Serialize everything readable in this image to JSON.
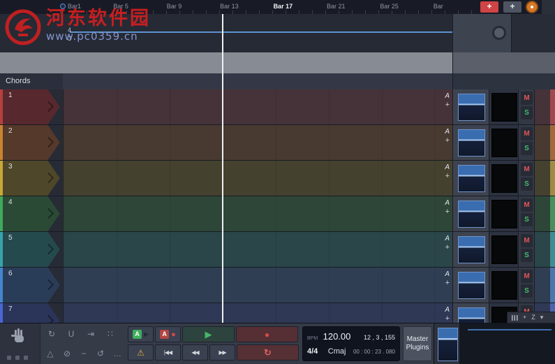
{
  "watermark": {
    "title": "河东软件园",
    "url": "www.pc0359.cn"
  },
  "ruler": {
    "bars": [
      {
        "label": "Bar1",
        "clock_icon": true
      },
      {
        "label": "Bar 5"
      },
      {
        "label": "Bar 9"
      },
      {
        "label": "Bar 13"
      },
      {
        "label": "Bar 17",
        "highlight": true
      },
      {
        "label": "Bar 21"
      },
      {
        "label": "Bar 25"
      },
      {
        "label": "Bar"
      }
    ],
    "add_track_label": "+",
    "add_label": "+"
  },
  "marker_area": {
    "beat": "4",
    "chord": "C"
  },
  "chords_row": {
    "label": "Chords"
  },
  "track_controls": {
    "automation": "A",
    "add": "+",
    "mute": "M",
    "solo": "S"
  },
  "tracks": [
    {
      "number": "1",
      "strip": "#b5403f",
      "header": "#57282e",
      "lane": "#463239",
      "edge": "#9e4a50"
    },
    {
      "number": "2",
      "strip": "#c9822f",
      "header": "#55392a",
      "lane": "#483a31",
      "edge": "#a06b3a"
    },
    {
      "number": "3",
      "strip": "#c7a73a",
      "header": "#4f4729",
      "lane": "#45412f",
      "edge": "#9d8c42"
    },
    {
      "number": "4",
      "strip": "#3fa95c",
      "header": "#2a4a35",
      "lane": "#2e4638",
      "edge": "#47905e"
    },
    {
      "number": "5",
      "strip": "#37a3ab",
      "header": "#254a4e",
      "lane": "#2a4649",
      "edge": "#3f8d94"
    },
    {
      "number": "6",
      "strip": "#4486cd",
      "header": "#2a3d58",
      "lane": "#2f3e53",
      "edge": "#4a77ad"
    },
    {
      "number": "7",
      "strip": "#4a66d2",
      "header": "#2b3459",
      "lane": "#2f3854",
      "edge": "#4c63b0"
    }
  ],
  "zoom_controls": {
    "plus": "+",
    "z_label": "Z"
  },
  "transport": {
    "bpm_label": "BPM",
    "bpm_value": "120.00",
    "position": "12 ,  3 , 155",
    "time_sig": "4/4",
    "key": "Cmaj",
    "time": "00 : 00 : 23 . 080",
    "master_line1": "Master",
    "master_line2": "Plugins"
  }
}
